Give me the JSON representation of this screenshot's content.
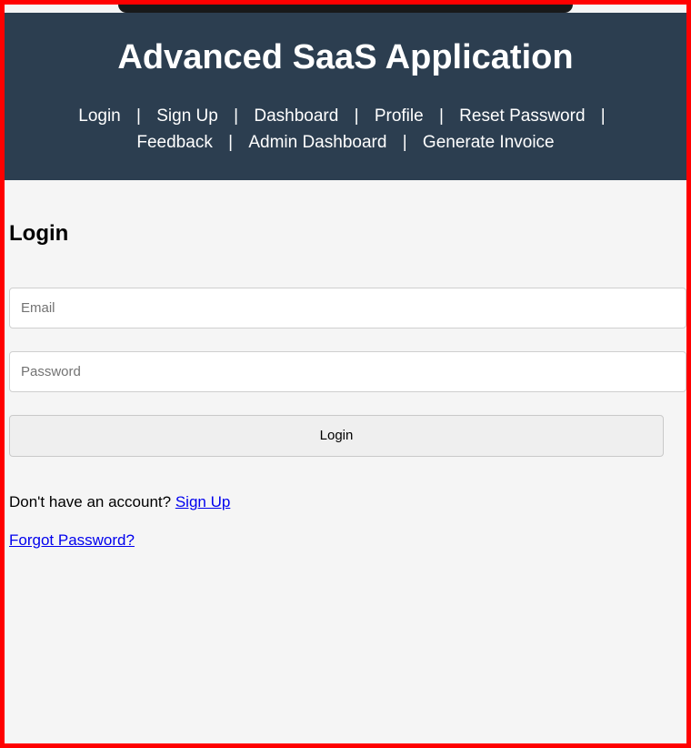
{
  "header": {
    "title": "Advanced SaaS Application",
    "nav": {
      "login": "Login",
      "signup": "Sign Up",
      "dashboard": "Dashboard",
      "profile": "Profile",
      "reset_password": "Reset Password",
      "feedback": "Feedback",
      "admin_dashboard": "Admin Dashboard",
      "generate_invoice": "Generate Invoice",
      "separator": "|"
    }
  },
  "page": {
    "title": "Login",
    "email_placeholder": "Email",
    "password_placeholder": "Password",
    "submit_label": "Login",
    "no_account_prefix": "Don't have an account? ",
    "signup_link": "Sign Up",
    "forgot_password_link": "Forgot Password?"
  },
  "colors": {
    "frame": "#ff0000",
    "header_bg": "#2c3e50",
    "body_bg": "#f5f5f5",
    "link": "#0000ee"
  }
}
